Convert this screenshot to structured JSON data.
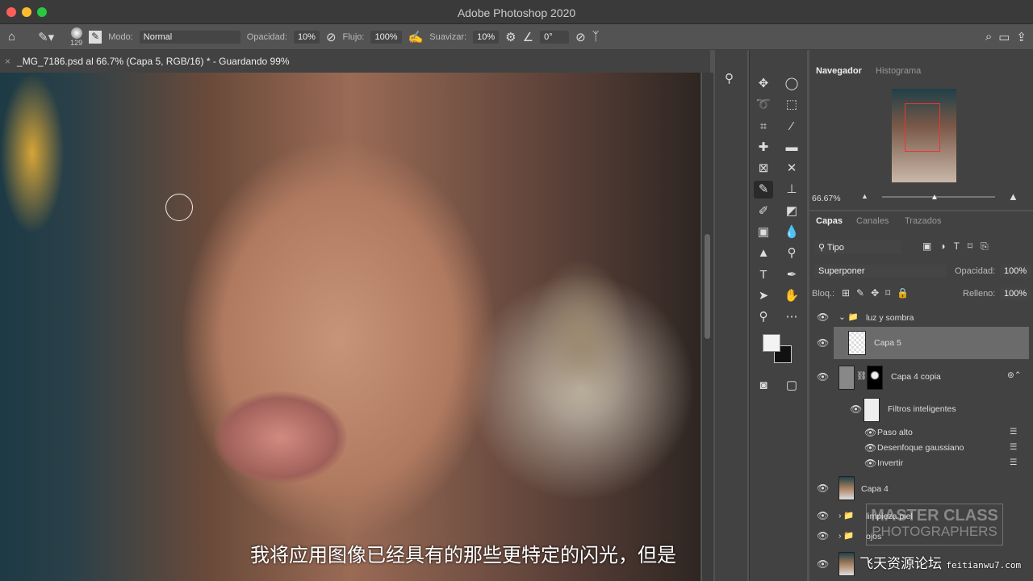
{
  "app_title": "Adobe Photoshop 2020",
  "options": {
    "brush_size": "129",
    "mode_label": "Modo:",
    "mode": "Normal",
    "opacity_label": "Opacidad:",
    "opacity": "10%",
    "flow_label": "Flujo:",
    "flow": "100%",
    "smooth_label": "Suavizar:",
    "smooth": "10%",
    "angle": "0°"
  },
  "document_tab": "_MG_7186.psd al 66.7% (Capa 5, RGB/16) * - Guardando 99%",
  "subtitle": "我将应用图像已经具有的那些更特定的闪光，但是",
  "navigator": {
    "tabs": [
      "Navegador",
      "Histograma"
    ],
    "zoom": "66.67%"
  },
  "layers_panel": {
    "tabs": [
      "Capas",
      "Canales",
      "Trazados"
    ],
    "filter": "Tipo",
    "blend_mode": "Superponer",
    "opacity_label": "Opacidad:",
    "opacity": "100%",
    "lock_label": "Bloq.:",
    "fill_label": "Relleno:",
    "fill": "100%",
    "layers": [
      {
        "name": "luz y sombra",
        "type": "group",
        "expanded": true
      },
      {
        "name": "Capa 5",
        "type": "layer",
        "selected": true
      },
      {
        "name": "Capa 4 copia",
        "type": "smart"
      },
      {
        "name": "Filtros inteligentes",
        "type": "filters"
      },
      {
        "name": "Paso alto",
        "type": "filter"
      },
      {
        "name": "Desenfoque gaussiano",
        "type": "filter"
      },
      {
        "name": "Invertir",
        "type": "filter"
      },
      {
        "name": "Capa 4",
        "type": "layer"
      },
      {
        "name": "limpieza piel",
        "type": "group"
      },
      {
        "name": "ojos",
        "type": "group"
      }
    ]
  },
  "watermark": {
    "line1": "MASTER CLASS",
    "line2": "PHOTOGRAPHERS",
    "site": "飞天资源论坛",
    "url": "feitianwu7.com"
  }
}
